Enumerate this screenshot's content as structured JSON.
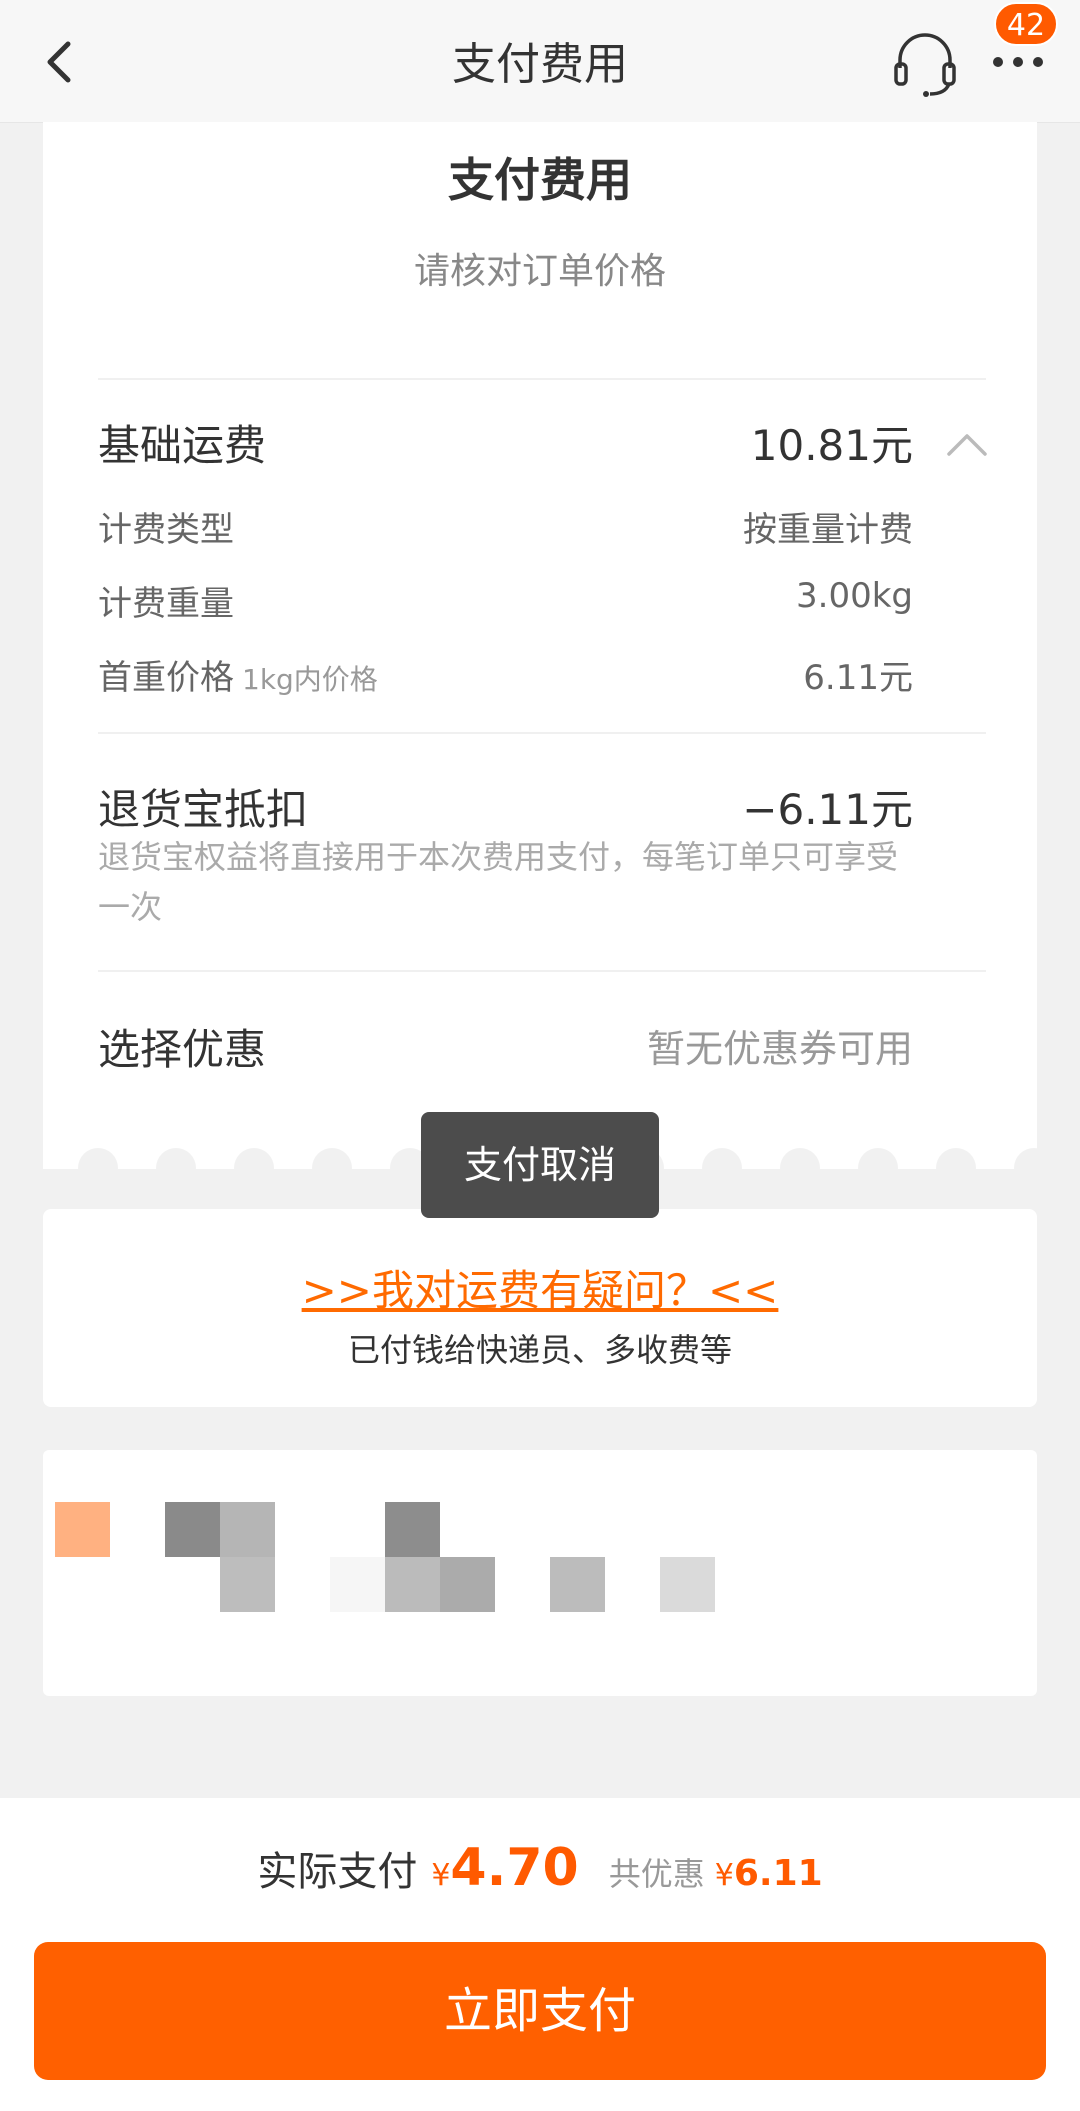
{
  "nav": {
    "title": "支付费用",
    "badge_count": "42"
  },
  "card": {
    "title": "支付费用",
    "subtitle": "请核对订单价格",
    "base_fee": {
      "label": "基础运费",
      "value": "10.81元"
    },
    "billing_type": {
      "label": "计费类型",
      "value": "按重量计费"
    },
    "billing_weight": {
      "label": "计费重量",
      "value": "3.00kg"
    },
    "first_weight_price": {
      "label": "首重价格",
      "hint": "1kg内价格",
      "value": "6.11元"
    },
    "return_deduction": {
      "label": "退货宝抵扣",
      "value": "−6.11元",
      "desc": "退货宝权益将直接用于本次费用支付，每笔订单只可享受一次"
    },
    "coupon": {
      "label": "选择优惠",
      "value": "暂无优惠券可用"
    }
  },
  "toast": "支付取消",
  "question": {
    "link": ">>我对运费有疑问？<<",
    "desc": "已付钱给快递员、多收费等"
  },
  "footer": {
    "pay_label": "实际支付",
    "currency": "¥",
    "pay_amount": "4.70",
    "discount_label": "共优惠",
    "discount_amount": "6.11",
    "pay_button": "立即支付"
  },
  "colors": {
    "accent": "#ff6000",
    "badge": "#ff5a00",
    "toast_bg": "#4c4c4c"
  },
  "icons": {
    "back": "chevron-left-icon",
    "customer_service": "headset-icon",
    "more": "more-dots-icon",
    "collapse": "chevron-up-icon"
  }
}
